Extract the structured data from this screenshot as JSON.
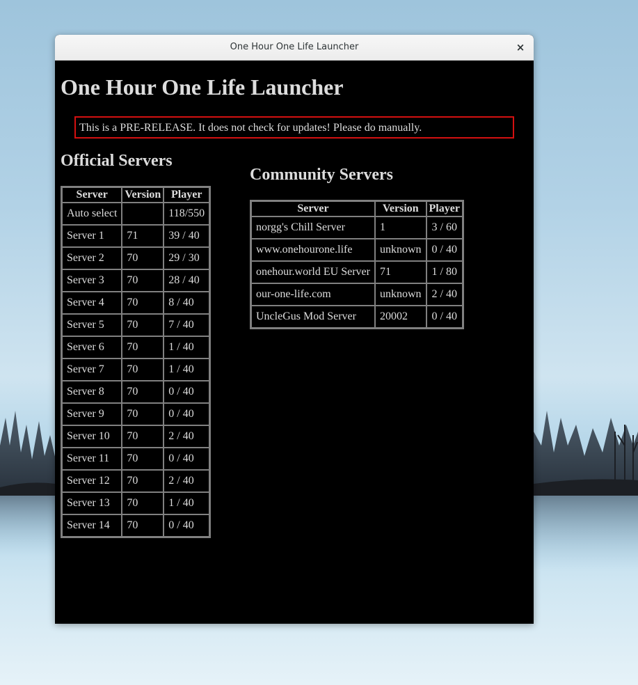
{
  "window": {
    "title": "One Hour One Life Launcher",
    "close_label": "×"
  },
  "page": {
    "heading": "One Hour One Life Launcher",
    "notice": "This is a PRE-RELEASE. It does not check for updates! Please do manually."
  },
  "official": {
    "heading": "Official Servers",
    "headers": [
      "Server",
      "Version",
      "Player"
    ],
    "rows": [
      {
        "server": "Auto select",
        "version": "",
        "player": "118/550"
      },
      {
        "server": "Server 1",
        "version": "71",
        "player": "39 / 40"
      },
      {
        "server": "Server 2",
        "version": "70",
        "player": "29 / 30"
      },
      {
        "server": "Server 3",
        "version": "70",
        "player": "28 / 40"
      },
      {
        "server": "Server 4",
        "version": "70",
        "player": "8 / 40"
      },
      {
        "server": "Server 5",
        "version": "70",
        "player": "7 / 40"
      },
      {
        "server": "Server 6",
        "version": "70",
        "player": "1 / 40"
      },
      {
        "server": "Server 7",
        "version": "70",
        "player": "1 / 40"
      },
      {
        "server": "Server 8",
        "version": "70",
        "player": "0 / 40"
      },
      {
        "server": "Server 9",
        "version": "70",
        "player": "0 / 40"
      },
      {
        "server": "Server 10",
        "version": "70",
        "player": "2 / 40"
      },
      {
        "server": "Server 11",
        "version": "70",
        "player": "0 / 40"
      },
      {
        "server": "Server 12",
        "version": "70",
        "player": "2 / 40"
      },
      {
        "server": "Server 13",
        "version": "70",
        "player": "1 / 40"
      },
      {
        "server": "Server 14",
        "version": "70",
        "player": "0 / 40"
      }
    ]
  },
  "community": {
    "heading": "Community Servers",
    "headers": [
      "Server",
      "Version",
      "Player"
    ],
    "rows": [
      {
        "server": "norgg's Chill Server",
        "version": "1",
        "player": "3 / 60"
      },
      {
        "server": "www.onehourone.life",
        "version": "unknown",
        "player": "0 / 40"
      },
      {
        "server": "onehour.world EU Server",
        "version": "71",
        "player": "1 / 80"
      },
      {
        "server": "our-one-life.com",
        "version": "unknown",
        "player": "2 / 40"
      },
      {
        "server": "UncleGus Mod Server",
        "version": "20002",
        "player": "0 / 40"
      }
    ]
  },
  "colors": {
    "window_background": "#000000",
    "text": "#dddddd",
    "notice_border": "#d41010",
    "table_border": "#808080"
  },
  "icons": {
    "close": "close-icon"
  }
}
